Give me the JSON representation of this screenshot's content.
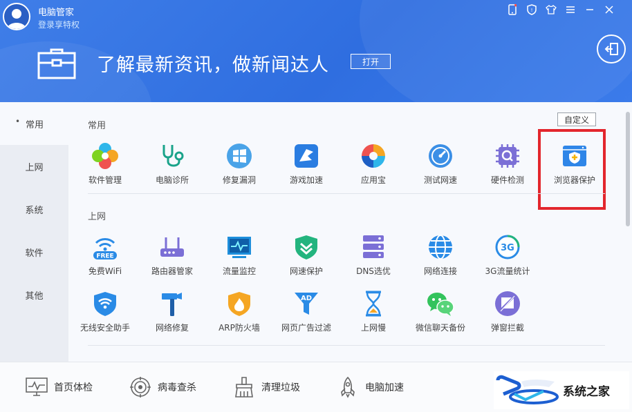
{
  "header": {
    "app_title": "电脑管家",
    "login_link": "登录享特权",
    "banner_text": "了解最新资讯，做新闻达人",
    "banner_button": "打开"
  },
  "leftnav": {
    "items": [
      {
        "label": "常用",
        "active": true
      },
      {
        "label": "上网",
        "active": false
      },
      {
        "label": "系统",
        "active": false
      },
      {
        "label": "软件",
        "active": false
      },
      {
        "label": "其他",
        "active": false
      }
    ]
  },
  "main": {
    "customize_button": "自定义",
    "sections": [
      {
        "title": "常用",
        "tools": [
          {
            "label": "软件管理",
            "icon": "software-manager-icon"
          },
          {
            "label": "电脑诊所",
            "icon": "stethoscope-icon"
          },
          {
            "label": "修复漏洞",
            "icon": "windows-repair-icon"
          },
          {
            "label": "游戏加速",
            "icon": "game-boost-icon"
          },
          {
            "label": "应用宝",
            "icon": "app-store-icon"
          },
          {
            "label": "测试网速",
            "icon": "speedometer-icon"
          },
          {
            "label": "硬件检测",
            "icon": "hardware-chip-icon"
          },
          {
            "label": "浏览器保护",
            "icon": "browser-shield-icon"
          }
        ]
      },
      {
        "title": "上网",
        "tools": [
          {
            "label": "免费WiFi",
            "icon": "free-wifi-icon",
            "badge": "FREE"
          },
          {
            "label": "路由器管家",
            "icon": "router-icon"
          },
          {
            "label": "流量监控",
            "icon": "traffic-monitor-icon"
          },
          {
            "label": "网速保护",
            "icon": "speed-shield-icon"
          },
          {
            "label": "DNS选优",
            "icon": "dns-server-icon"
          },
          {
            "label": "网络连接",
            "icon": "globe-icon"
          },
          {
            "label": "3G流量统计",
            "icon": "3g-data-icon",
            "badge": "3G"
          },
          {
            "label": "无线安全助手",
            "icon": "wifi-shield-icon"
          },
          {
            "label": "网络修复",
            "icon": "hammer-icon"
          },
          {
            "label": "ARP防火墙",
            "icon": "firewall-icon"
          },
          {
            "label": "网页广告过滤",
            "icon": "ad-filter-icon",
            "badge": "AD"
          },
          {
            "label": "上网慢",
            "icon": "hourglass-icon"
          },
          {
            "label": "微信聊天备份",
            "icon": "wechat-icon"
          },
          {
            "label": "弹窗拦截",
            "icon": "popup-block-icon"
          }
        ]
      }
    ]
  },
  "bottombar": {
    "items": [
      {
        "label": "首页体检",
        "icon": "monitor-pulse-icon"
      },
      {
        "label": "病毒查杀",
        "icon": "virus-scan-icon"
      },
      {
        "label": "清理垃圾",
        "icon": "broom-icon"
      },
      {
        "label": "电脑加速",
        "icon": "rocket-icon"
      }
    ]
  },
  "watermark": {
    "text": "系统之家"
  },
  "colors": {
    "header_blue": "#3275e4",
    "highlight_red": "#e3262d",
    "nav_bg": "#eaedf3"
  }
}
